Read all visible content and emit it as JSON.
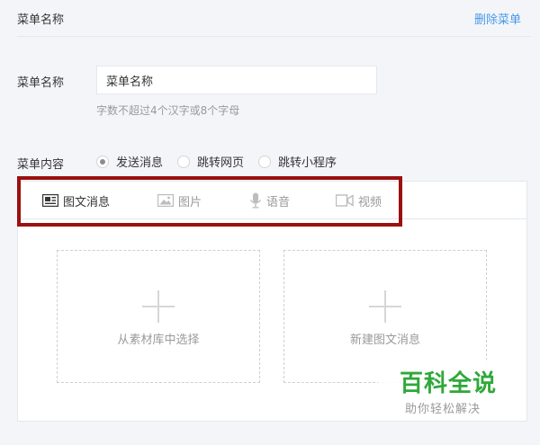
{
  "header": {
    "title": "菜单名称",
    "delete_label": "删除菜单"
  },
  "name_field": {
    "label": "菜单名称",
    "value": "菜单名称",
    "hint": "字数不超过4个汉字或8个字母"
  },
  "content": {
    "label": "菜单内容",
    "options": [
      {
        "label": "发送消息",
        "checked": true
      },
      {
        "label": "跳转网页",
        "checked": false
      },
      {
        "label": "跳转小程序",
        "checked": false
      }
    ],
    "tabs": [
      {
        "label": "图文消息",
        "icon": "news-icon",
        "active": true
      },
      {
        "label": "图片",
        "icon": "image-icon",
        "active": false
      },
      {
        "label": "语音",
        "icon": "microphone-icon",
        "active": false
      },
      {
        "label": "视频",
        "icon": "video-icon",
        "active": false
      }
    ],
    "cards": [
      {
        "label": "从素材库中选择"
      },
      {
        "label": "新建图文消息"
      }
    ]
  },
  "watermark": {
    "brand": "百科全说",
    "slogan": "助你轻松解决"
  },
  "colors": {
    "link": "#459ae9",
    "highlight": "#9b1010",
    "brand": "#2fa83a"
  }
}
